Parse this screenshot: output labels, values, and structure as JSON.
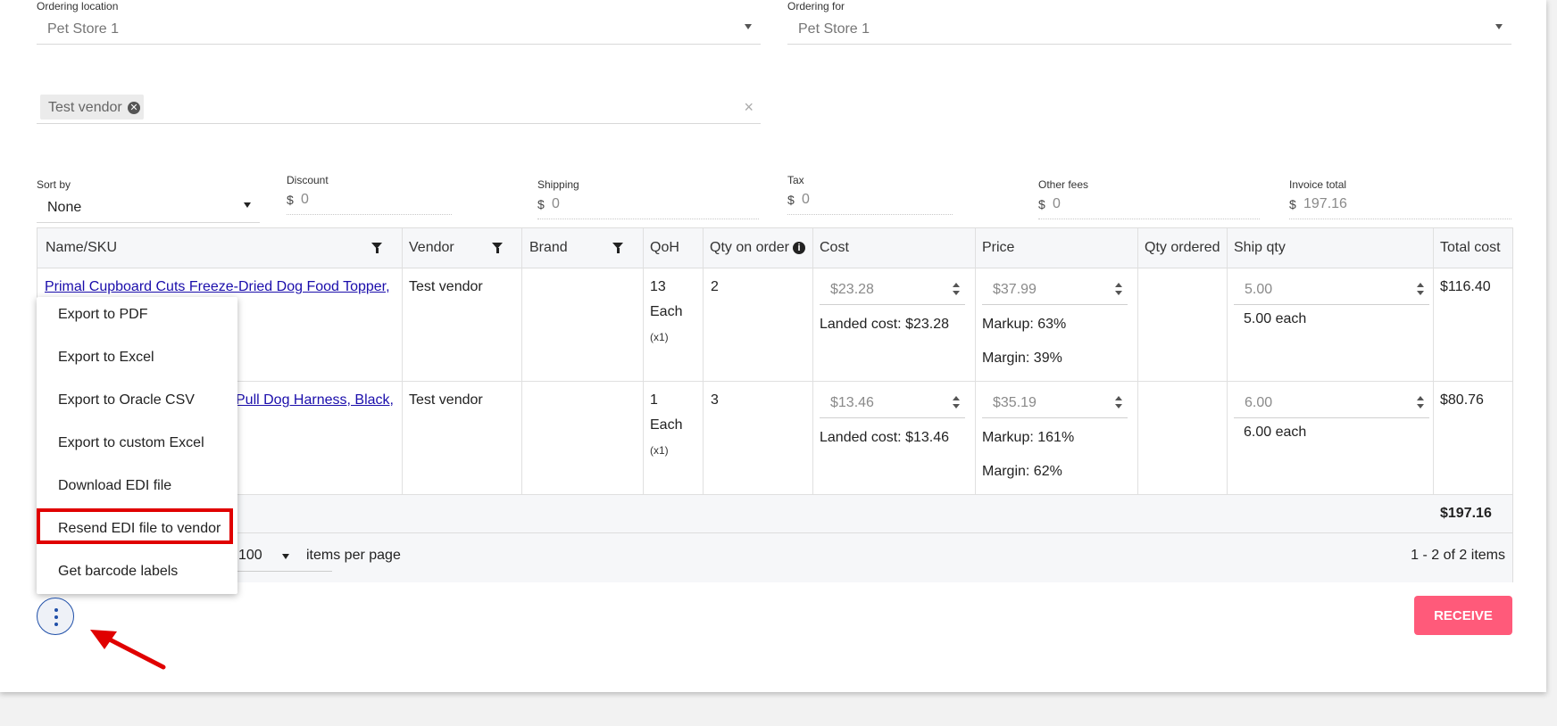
{
  "ordering_location": {
    "label": "Ordering location",
    "value": "Pet Store 1"
  },
  "ordering_for": {
    "label": "Ordering for",
    "value": "Pet Store 1"
  },
  "vendor_filter": {
    "chip": "Test vendor"
  },
  "sort_by": {
    "label": "Sort by",
    "value": "None"
  },
  "fees": {
    "discount": {
      "label": "Discount",
      "currency": "$",
      "value": "0"
    },
    "shipping": {
      "label": "Shipping",
      "currency": "$",
      "value": "0"
    },
    "tax": {
      "label": "Tax",
      "currency": "$",
      "value": "0"
    },
    "other_fees": {
      "label": "Other fees",
      "currency": "$",
      "value": "0"
    },
    "invoice_total": {
      "label": "Invoice total",
      "currency": "$",
      "value": "197.16"
    }
  },
  "table": {
    "headers": [
      "Name/SKU",
      "Vendor",
      "Brand",
      "QoH",
      "Qty on order",
      "Cost",
      "Price",
      "Qty ordered",
      "Ship qty",
      "Total cost"
    ],
    "rows": [
      {
        "name": "Primal Cupboard Cuts Freeze-Dried Dog Food Topper,",
        "vendor": "Test vendor",
        "qoh": "13",
        "qoh_unit": "Each",
        "qoh_mult": "(x1)",
        "qty_on_order": "2",
        "cost": "$23.28",
        "landed_cost": "Landed cost: $23.28",
        "price": "$37.99",
        "markup": "Markup: 63%",
        "margin": "Margin: 39%",
        "ship_qty": "5.00",
        "ship_each": "5.00 each",
        "total": "$116.40"
      },
      {
        "name": "Pull Dog Harness, Black,",
        "vendor": "Test vendor",
        "qoh": "1",
        "qoh_unit": "Each",
        "qoh_mult": "(x1)",
        "qty_on_order": "3",
        "cost": "$13.46",
        "landed_cost": "Landed cost: $13.46",
        "price": "$35.19",
        "markup": "Markup: 161%",
        "margin": "Margin: 62%",
        "ship_qty": "6.00",
        "ship_each": "6.00 each",
        "total": "$80.76"
      }
    ],
    "grand_total": "$197.16"
  },
  "pager": {
    "page_size": "100",
    "per_page_label": "items per page",
    "summary": "1 - 2 of 2 items"
  },
  "menu": {
    "items": [
      "Export to PDF",
      "Export to Excel",
      "Export to Oracle CSV",
      "Export to custom Excel",
      "Download EDI file",
      "Resend EDI file to vendor",
      "Get barcode labels"
    ]
  },
  "actions": {
    "receive": "RECEIVE"
  },
  "colors": {
    "accent": "#ff5a7a",
    "highlight": "#e00000",
    "link": "#1a0dab"
  }
}
